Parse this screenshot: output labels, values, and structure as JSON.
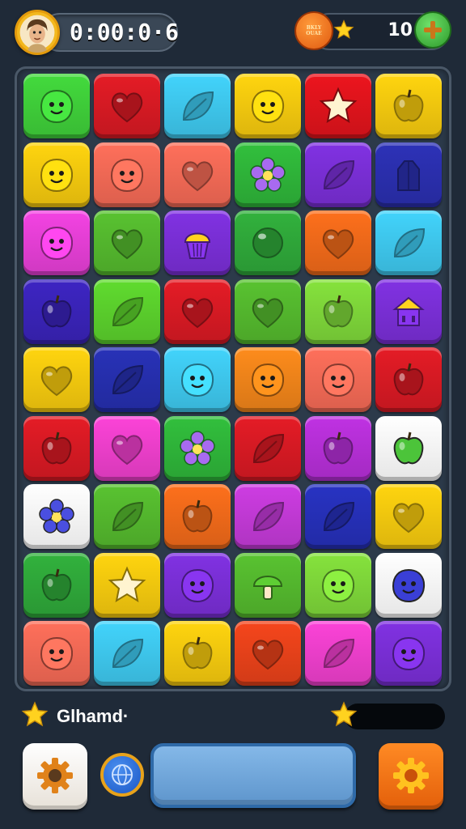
{
  "hud": {
    "timer": "0:00:0·6",
    "coin_badge_line1": "BKLY",
    "coin_badge_line2": "OUAE",
    "coins": "10"
  },
  "footer": {
    "player_label": "Glhamd·"
  },
  "progress": {
    "fraction": 0
  },
  "board": {
    "rows": 9,
    "cols": 6,
    "tiles": [
      [
        {
          "color": "#3fcf3a",
          "icon": "blob-smile-icon"
        },
        {
          "color": "#d81a24",
          "icon": "heart-icon"
        },
        {
          "color": "#3ec8ee",
          "icon": "leaf-icon"
        },
        {
          "color": "#f6c90e",
          "icon": "blob-smile-icon"
        },
        {
          "color": "#e0141c",
          "icon": "star-icon"
        },
        {
          "color": "#f6c90e",
          "icon": "apple-icon"
        }
      ],
      [
        {
          "color": "#f6c90e",
          "icon": "blob-smile-icon"
        },
        {
          "color": "#f46a56",
          "icon": "blob-smile-icon"
        },
        {
          "color": "#f46a56",
          "icon": "heart-icon"
        },
        {
          "color": "#2fb53a",
          "icon": "flower-icon"
        },
        {
          "color": "#7a2fd6",
          "icon": "leaf-icon"
        },
        {
          "color": "#2a2fae",
          "icon": "gem-icon"
        }
      ],
      [
        {
          "color": "#e63fd6",
          "icon": "blob-smile-icon"
        },
        {
          "color": "#54b82e",
          "icon": "heart-icon"
        },
        {
          "color": "#7a2fd6",
          "icon": "cupcake-icon"
        },
        {
          "color": "#2fa83a",
          "icon": "orb-icon"
        },
        {
          "color": "#f06a1a",
          "icon": "heart-icon"
        },
        {
          "color": "#3ec8ee",
          "icon": "leaf-icon"
        }
      ],
      [
        {
          "color": "#3a23b8",
          "icon": "apple-icon"
        },
        {
          "color": "#5bd02c",
          "icon": "leaf-icon"
        },
        {
          "color": "#d81a24",
          "icon": "heart-icon"
        },
        {
          "color": "#54b82e",
          "icon": "heart-icon"
        },
        {
          "color": "#7ed63a",
          "icon": "apple-icon"
        },
        {
          "color": "#7a2fd6",
          "icon": "house-icon"
        }
      ],
      [
        {
          "color": "#f6c90e",
          "icon": "heart-icon"
        },
        {
          "color": "#262fae",
          "icon": "leaf-icon"
        },
        {
          "color": "#3ec8ee",
          "icon": "blob-smile-icon"
        },
        {
          "color": "#f0841a",
          "icon": "blob-smile-icon"
        },
        {
          "color": "#f46a56",
          "icon": "blob-smile-icon"
        },
        {
          "color": "#d81a24",
          "icon": "apple-icon"
        }
      ],
      [
        {
          "color": "#d81a24",
          "icon": "apple-icon"
        },
        {
          "color": "#ee3fcc",
          "icon": "heart-icon"
        },
        {
          "color": "#2fb53a",
          "icon": "flower-icon"
        },
        {
          "color": "#d81a24",
          "icon": "leaf-icon"
        },
        {
          "color": "#b52fd6",
          "icon": "apple-icon"
        },
        {
          "color": "#ffffff",
          "icon": "apple-icon"
        }
      ],
      [
        {
          "color": "#ffffff",
          "icon": "flower-icon"
        },
        {
          "color": "#54b82e",
          "icon": "leaf-icon"
        },
        {
          "color": "#f06a1a",
          "icon": "apple-icon"
        },
        {
          "color": "#c23ad6",
          "icon": "leaf-icon"
        },
        {
          "color": "#2630b8",
          "icon": "leaf-icon"
        },
        {
          "color": "#f6c90e",
          "icon": "heart-icon"
        }
      ],
      [
        {
          "color": "#2fa83a",
          "icon": "apple-icon"
        },
        {
          "color": "#f6c90e",
          "icon": "star-icon"
        },
        {
          "color": "#7a2fd6",
          "icon": "blob-smile-icon"
        },
        {
          "color": "#54b82e",
          "icon": "mushroom-icon"
        },
        {
          "color": "#7ed63a",
          "icon": "blob-smile-icon"
        },
        {
          "color": "#ffffff",
          "icon": "blob-smile-icon"
        }
      ],
      [
        {
          "color": "#f46a56",
          "icon": "blob-smile-icon"
        },
        {
          "color": "#3ec8ee",
          "icon": "leaf-icon"
        },
        {
          "color": "#f6c90e",
          "icon": "apple-icon"
        },
        {
          "color": "#e8421a",
          "icon": "heart-icon"
        },
        {
          "color": "#ee3fcc",
          "icon": "leaf-icon"
        },
        {
          "color": "#7a2fd6",
          "icon": "blob-smile-icon"
        }
      ]
    ]
  },
  "icon_fill": {
    "default": "#ffffff",
    "on_white": "#3a3fd6"
  }
}
